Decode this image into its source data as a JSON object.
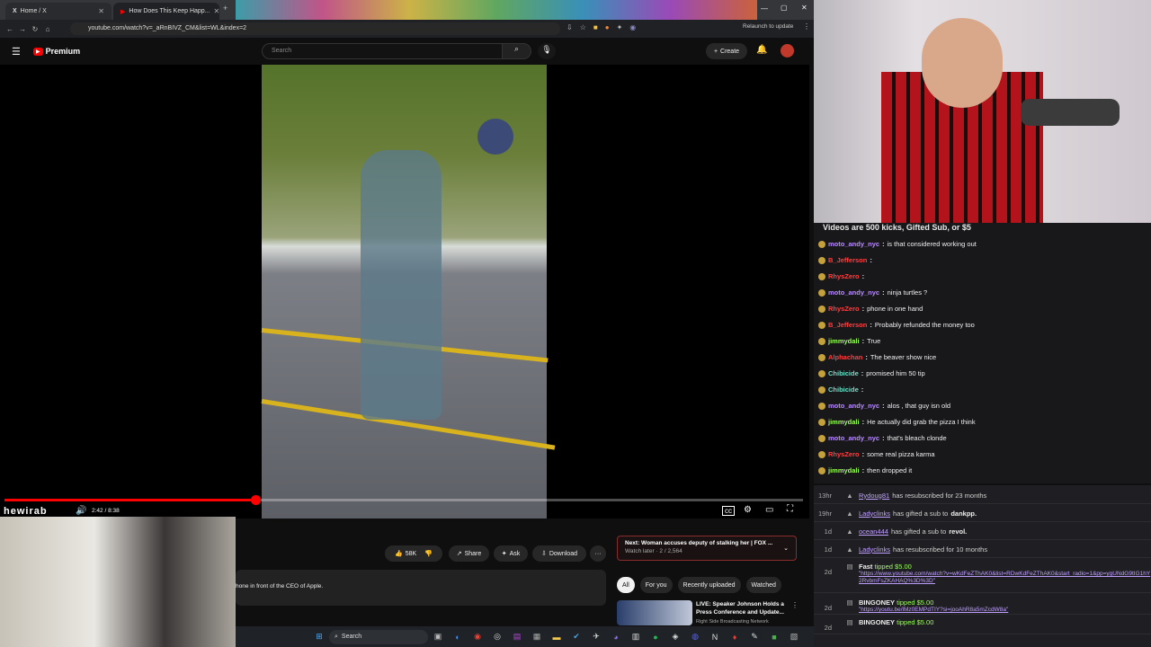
{
  "browser": {
    "tabs": [
      {
        "label": "Home / X"
      },
      {
        "label": "How Does This Keep Happ..."
      }
    ],
    "url": "youtube.com/watch?v=_aRnBIVZ_CM&list=WL&index=2",
    "relaunch_label": "Relaunch to update"
  },
  "youtube": {
    "logo_label": "Premium",
    "search_placeholder": "Search",
    "create_label": "Create",
    "watermark": "hewirab",
    "time": "2:42 / 8:38",
    "progress_fraction": 0.314,
    "actions": {
      "likes": "58K",
      "share": "Share",
      "ask": "Ask",
      "download": "Download"
    },
    "description": "hone in front of the CEO of Apple.",
    "next": {
      "title": "Next: Woman accuses deputy of stalking her | FOX ...",
      "sub": "Watch later · 2 / 2,564"
    },
    "chips": [
      "All",
      "For you",
      "Recently uploaded",
      "Watched"
    ],
    "rec": {
      "title": "LIVE: Speaker Johnson Holds a Press Conference and Update...",
      "channel": "Right Side Broadcasting Network"
    }
  },
  "chat": {
    "banner": "Videos are 500 kicks, Gifted Sub, or $5",
    "messages": [
      {
        "user": "moto_andy_nyc",
        "color": "#b98cff",
        "text": "is that considered working out"
      },
      {
        "user": "B_Jefferson",
        "color": "#ff3f3f",
        "text": ""
      },
      {
        "user": "RhysZero",
        "color": "#ff3f3f",
        "text": ""
      },
      {
        "user": "moto_andy_nyc",
        "color": "#b98cff",
        "text": "ninja turtles ?"
      },
      {
        "user": "RhysZero",
        "color": "#ff3f3f",
        "text": "phone in one hand"
      },
      {
        "user": "B_Jefferson",
        "color": "#ff3f3f",
        "text": "Probably refunded the money too"
      },
      {
        "user": "jimmydali",
        "color": "#9cff5a",
        "text": "True"
      },
      {
        "user": "Alphachan",
        "color": "#ff3f3f",
        "text": "The beaver show nice"
      },
      {
        "user": "Chibicide",
        "color": "#6ee0c8",
        "text": "promised him 50 tip"
      },
      {
        "user": "Chibicide",
        "color": "#6ee0c8",
        "text": ""
      },
      {
        "user": "moto_andy_nyc",
        "color": "#b98cff",
        "text": "alos , that guy isn old"
      },
      {
        "user": "jimmydali",
        "color": "#9cff5a",
        "text": "He actually did grab the pizza I think"
      },
      {
        "user": "moto_andy_nyc",
        "color": "#b98cff",
        "text": "that's bleach clonde"
      },
      {
        "user": "RhysZero",
        "color": "#ff3f3f",
        "text": "some real pizza karma"
      },
      {
        "user": "jimmydali",
        "color": "#9cff5a",
        "text": "then dropped it"
      }
    ]
  },
  "events": [
    {
      "time": "13hr",
      "name": "Rydoug81",
      "text": "has resubscribed for 23 months",
      "extra": ""
    },
    {
      "time": "19hr",
      "name": "Ladyclinks",
      "text": "has gifted a sub to",
      "extra": "dankpp."
    },
    {
      "time": "1d",
      "name": "ocean444",
      "text": "has gifted a sub to",
      "extra": "revol."
    },
    {
      "time": "1d",
      "name": "Ladyclinks",
      "text": "has resubscribed for 10 months",
      "extra": ""
    }
  ],
  "tips": [
    {
      "time": "2d",
      "name": "Fast",
      "text": "tipped $5.00",
      "link": "\"https://www.youtube.com/watch?v=wKdFeZThAK0&list=RDwKdFeZThAK0&start_radio=1&pp=ygUNdG9tIG1hY2RvbmFsZKAHAQ%3D%3D\""
    },
    {
      "time": "2d",
      "name": "BINGONEY",
      "text": "tipped $5.00",
      "link": "\"https://youtu.be/lMz0EMPdTIY?si=jooAhR8a5mZcdW8a\""
    },
    {
      "time": "2d",
      "name": "BINGONEY",
      "text": "tipped $5.00",
      "link": ""
    }
  ],
  "taskbar": {
    "search_label": "Search"
  },
  "colors": {
    "accent": "#ff0000",
    "chat_bg": "#18181b",
    "link": "#c0a0ff"
  }
}
